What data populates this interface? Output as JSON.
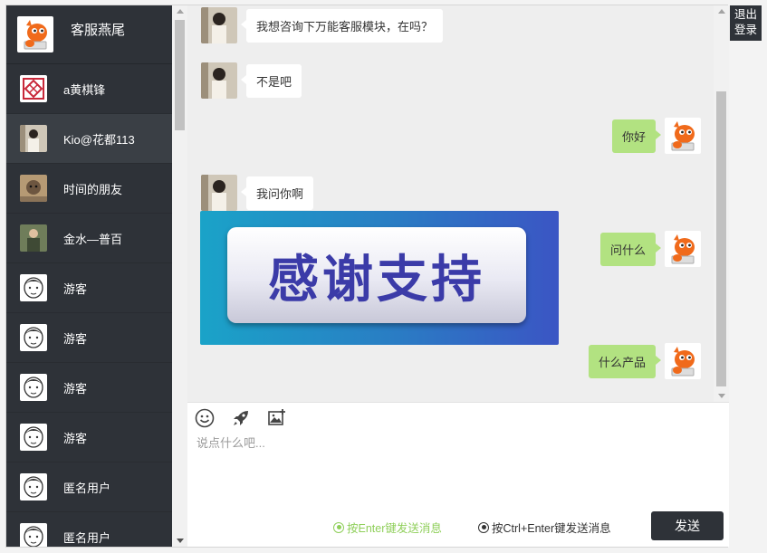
{
  "self": {
    "name": "客服燕尾"
  },
  "contacts": [
    {
      "name": "a黄棋锋"
    },
    {
      "name": "Kio@花都113"
    },
    {
      "name": "时间的朋友"
    },
    {
      "name": "金水—普百"
    },
    {
      "name": "游客"
    },
    {
      "name": "游客"
    },
    {
      "name": "游客"
    },
    {
      "name": "游客"
    },
    {
      "name": "匿名用户"
    },
    {
      "name": "匿名用户"
    }
  ],
  "messages": [
    {
      "side": "left",
      "text": "我想咨询下万能客服模块，在吗？"
    },
    {
      "side": "left",
      "text": "不是吧"
    },
    {
      "side": "right",
      "text": "你好"
    },
    {
      "side": "left",
      "text": "我问你啊"
    },
    {
      "side": "right",
      "text": "问什么"
    },
    {
      "side": "right",
      "text": "什么产品"
    }
  ],
  "image_message": {
    "text": "感谢支持"
  },
  "composer": {
    "placeholder": "说点什么吧...",
    "tools": [
      "emoji-icon",
      "rocket-icon",
      "image-upload-icon"
    ],
    "send_option_enter": "按Enter键发送消息",
    "send_option_ctrl": "按Ctrl+Enter键发送消息",
    "send_label": "发送"
  },
  "logout": {
    "line1": "退出",
    "line2": "登录"
  },
  "colors": {
    "sidebar": "#2e3238",
    "bubble_right": "#b2e281",
    "accent_green": "#8fcf5a"
  }
}
